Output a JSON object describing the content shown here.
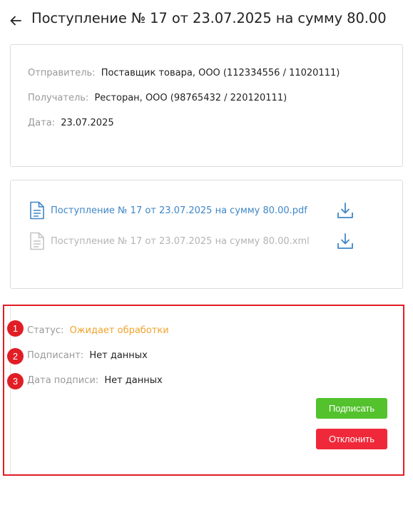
{
  "header": {
    "back_icon": "arrow-left-icon",
    "title": "Поступление № 17 от 23.07.2025 на сумму 80.00"
  },
  "info": {
    "sender_label": "Отправитель:",
    "sender_value": "Поставщик товара, ООО (112334556 / 11020111)",
    "recipient_label": "Получатель:",
    "recipient_value": "Ресторан, ООО (98765432 / 220120111)",
    "date_label": "Дата:",
    "date_value": "23.07.2025"
  },
  "files": [
    {
      "name": "Поступление № 17 от 23.07.2025 на сумму 80.00.pdf",
      "icon": "document-icon",
      "download_icon": "download-icon",
      "state": "active"
    },
    {
      "name": "Поступление № 17 от 23.07.2025 на сумму 80.00.xml",
      "icon": "document-icon",
      "download_icon": "download-icon",
      "state": "disabled"
    }
  ],
  "signing": {
    "markers": [
      "1",
      "2",
      "3"
    ],
    "status_label": "Статус:",
    "status_value": "Ожидает обработки",
    "signer_label": "Подписант:",
    "signer_value": "Нет данных",
    "sign_date_label": "Дата подписи:",
    "sign_date_value": "Нет данных",
    "sign_button": "Подписать",
    "reject_button": "Отклонить"
  },
  "colors": {
    "link": "#3f86c6",
    "status_pending": "#f0a32d",
    "sign_button": "#53c22d",
    "reject_button": "#f0293a",
    "highlight_frame": "#e11d25"
  }
}
